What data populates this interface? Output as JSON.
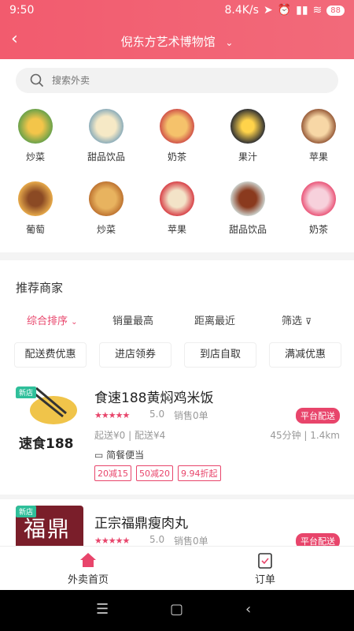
{
  "status_bar": {
    "time": "9:50",
    "speed": "8.4K/s",
    "battery": "88"
  },
  "header": {
    "title": "倪东方艺术博物馆",
    "back": "‹",
    "chevron": "⌄"
  },
  "search": {
    "placeholder": "搜索外卖"
  },
  "categories": [
    "炒菜",
    "甜品饮品",
    "奶茶",
    "果汁",
    "苹果",
    "葡萄",
    "炒菜",
    "苹果",
    "甜品饮品",
    "奶茶"
  ],
  "section": {
    "title": "推荐商家"
  },
  "sorts": [
    "综合排序",
    "销量最高",
    "距离最近",
    "筛选"
  ],
  "chips": [
    "配送费优惠",
    "进店领券",
    "到店自取",
    "满减优惠"
  ],
  "stores": [
    {
      "name": "食速188黄焖鸡米饭",
      "badge": "新店",
      "logo_text": "速食188",
      "rating": "5.0",
      "sales": "销售0单",
      "platform": "平台配送",
      "fees": "起送¥0 | 配送¥4",
      "time_dist": "45分钟 | 1.4km",
      "note": "简餐便当",
      "tags": [
        "20减15",
        "50减20",
        "9.94折起"
      ]
    },
    {
      "name": "正宗福鼎瘦肉丸",
      "badge": "新店",
      "logo_text": "福鼎",
      "rating": "5.0",
      "sales": "销售0单",
      "platform": "平台配送"
    }
  ],
  "tabs": {
    "home": "外卖首页",
    "orders": "订单"
  },
  "colors": {
    "brand": "#f25b6e",
    "accent": "#e8456b"
  }
}
